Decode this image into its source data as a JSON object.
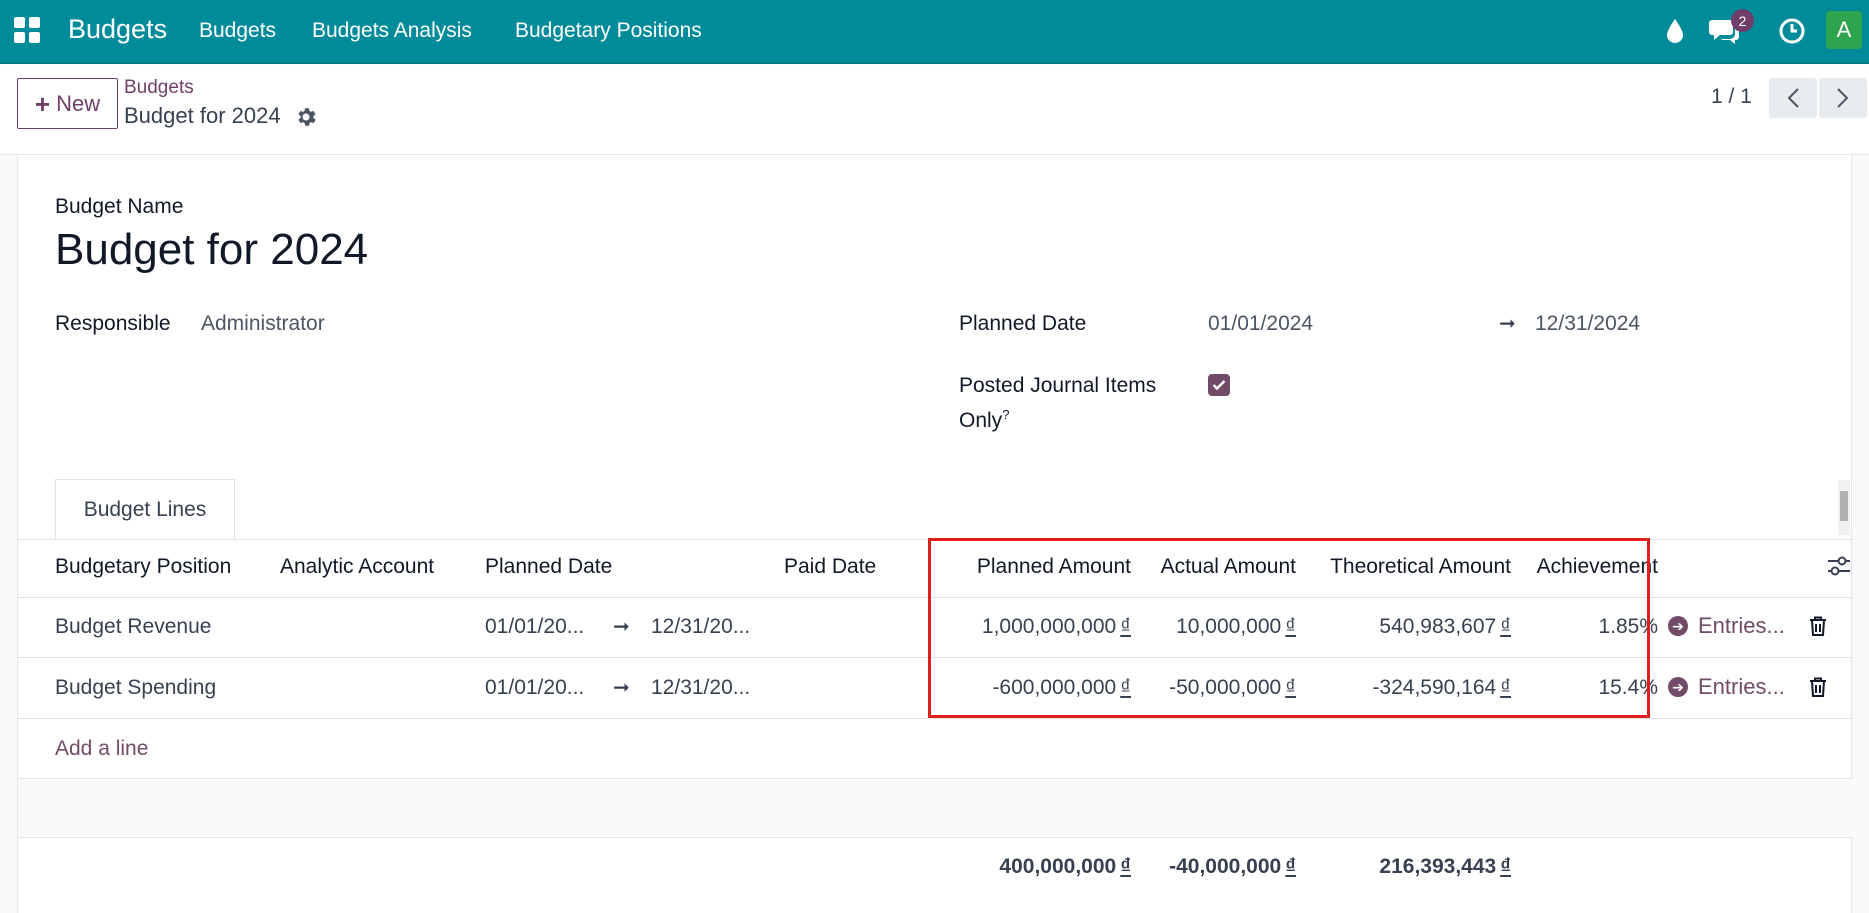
{
  "navbar": {
    "brand": "Budgets",
    "menu": [
      "Budgets",
      "Budgets Analysis",
      "Budgetary Positions"
    ],
    "message_count": "2",
    "avatar_letter": "A",
    "color": "#008b9a"
  },
  "control": {
    "new_label": "New",
    "breadcrumb_parent": "Budgets",
    "breadcrumb_current": "Budget for 2024",
    "pager": "1 / 1"
  },
  "form": {
    "name_label": "Budget Name",
    "name": "Budget for 2024",
    "responsible_label": "Responsible",
    "responsible": "Administrator",
    "planned_date_label": "Planned Date",
    "date_start": "01/01/2024",
    "date_end": "12/31/2024",
    "posted_label_1": "Posted Journal Items",
    "posted_label_2": "Only",
    "posted_help": "?",
    "posted_checked": true
  },
  "tab": {
    "label": "Budget Lines"
  },
  "table": {
    "headers": [
      "Budgetary Position",
      "Analytic Account",
      "Planned Date",
      "Paid Date",
      "Planned Amount",
      "Actual Amount",
      "Theoretical Amount",
      "Achievement"
    ],
    "rows": [
      {
        "position": "Budget Revenue",
        "date_from": "01/01/20...",
        "date_to": "12/31/20...",
        "planned": "1,000,000,000",
        "actual": "10,000,000",
        "theoretical": "540,983,607",
        "achievement": "1.85%",
        "entries": "Entries..."
      },
      {
        "position": "Budget Spending",
        "date_from": "01/01/20...",
        "date_to": "12/31/20...",
        "planned": "-600,000,000",
        "actual": "-50,000,000",
        "theoretical": "-324,590,164",
        "achievement": "15.4%",
        "entries": "Entries..."
      }
    ],
    "currency": "₫",
    "add_line": "Add a line",
    "totals": {
      "planned": "400,000,000",
      "actual": "-40,000,000",
      "theoretical": "216,393,443"
    }
  },
  "colors": {
    "accent": "#714b67",
    "highlight": "#e01e1e"
  }
}
